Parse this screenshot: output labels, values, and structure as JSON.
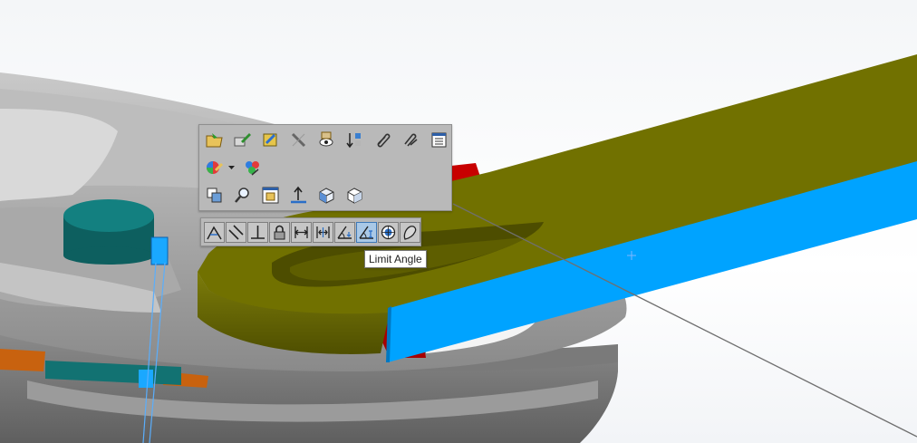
{
  "tooltip": {
    "text": "Limit Angle"
  },
  "context_toolbar": {
    "row1": [
      "open-part-icon",
      "edit-part-icon",
      "change-appearance-icon",
      "hide-show-components-icon",
      "isolate-icon",
      "insert-mate-icon",
      "attach-icon",
      "reattach-icon",
      "component-properties-icon"
    ],
    "row2": [
      "appearance-icon",
      "component-appearance-icon"
    ],
    "row3": [
      "copy-with-mates-icon",
      "zoom-to-selection-icon",
      "view-mates-icon",
      "normal-to-icon",
      "view-orientation-icon",
      "display-style-icon"
    ]
  },
  "mate_toolbar": {
    "buttons": [
      "coincident",
      "parallel",
      "perpendicular",
      "lock",
      "distance",
      "limit-distance",
      "angle",
      "limit-angle",
      "concentric",
      "tangent"
    ],
    "hovered": "limit-angle"
  },
  "colors": {
    "part_olive": "#6e6e00",
    "part_blue": "#00a3ff",
    "part_red": "#c40000",
    "part_teal": "#0f6f6f",
    "part_gray": "#9a9a9a",
    "toolbar_bg": "#b9b9b9",
    "hover_blue": "#a9c8e6"
  }
}
